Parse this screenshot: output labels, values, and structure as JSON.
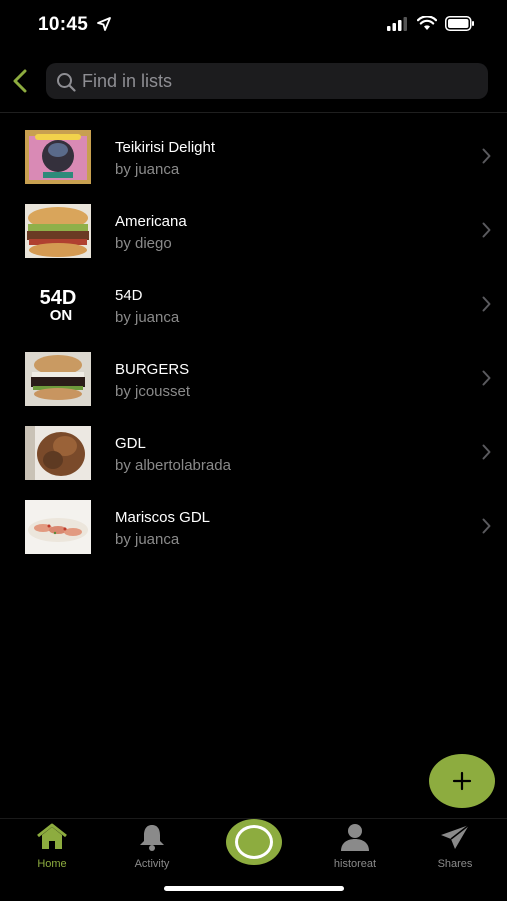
{
  "status": {
    "time": "10:45"
  },
  "header": {
    "search_placeholder": "Find in lists"
  },
  "lists": [
    {
      "title": "Teikirisi Delight",
      "author": "by juanca",
      "thumb": "thumb-teikirisi"
    },
    {
      "title": "Americana",
      "author": "by diego",
      "thumb": "thumb-americana"
    },
    {
      "title": "54D",
      "author": "by juanca",
      "thumb": "thumb-54d",
      "logo_line1": "54D",
      "logo_line2": "ON"
    },
    {
      "title": "BURGERS",
      "author": "by jcousset",
      "thumb": "thumb-burgers"
    },
    {
      "title": "GDL",
      "author": "by albertolabrada",
      "thumb": "thumb-gdl"
    },
    {
      "title": "Mariscos GDL",
      "author": "by juanca",
      "thumb": "thumb-mariscos"
    }
  ],
  "tabs": [
    {
      "label": "Home",
      "icon": "home-icon",
      "active": true
    },
    {
      "label": "Activity",
      "icon": "bell-icon",
      "active": false
    },
    {
      "label": "",
      "icon": "center-action",
      "active": false
    },
    {
      "label": "historeat",
      "icon": "person-icon",
      "active": false
    },
    {
      "label": "Shares",
      "icon": "paper-plane-icon",
      "active": false
    }
  ],
  "colors": {
    "accent": "#8dac3f",
    "background": "#000000",
    "secondary_text": "#8a8a8a"
  }
}
